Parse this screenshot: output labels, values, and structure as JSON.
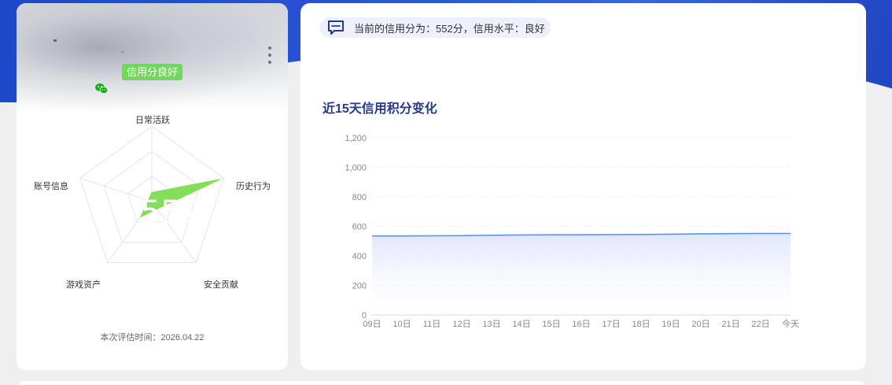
{
  "profile": {
    "name_placeholder": "-",
    "badge": "信用分良好",
    "social_icon": "wechat-icon",
    "more_icon": "more-vertical-icon"
  },
  "radar": {
    "score": "552",
    "axes": [
      {
        "label": "日常活跃",
        "value": 0.12
      },
      {
        "label": "历史行为",
        "value": 0.95
      },
      {
        "label": "安全贡献",
        "value": 0.12
      },
      {
        "label": "游戏资产",
        "value": 0.25
      },
      {
        "label": "账号信息",
        "value": 0.05
      }
    ],
    "eval_time": "本次评估时间：2026.04.22"
  },
  "notice": {
    "icon": "message-icon",
    "text": "当前的信用分为：552分，信用水平：良好"
  },
  "chart_data": {
    "type": "area",
    "title": "近15天信用积分变化",
    "categories": [
      "09日",
      "10日",
      "11日",
      "12日",
      "13日",
      "14日",
      "15日",
      "16日",
      "17日",
      "18日",
      "19日",
      "20日",
      "21日",
      "22日",
      "今天"
    ],
    "values": [
      535,
      535,
      536,
      537,
      540,
      542,
      543,
      543,
      544,
      545,
      547,
      549,
      551,
      552,
      552
    ],
    "ylim": [
      0,
      1200
    ],
    "yticks": [
      "0",
      "200",
      "400",
      "600",
      "800",
      "1,000",
      "1,200"
    ],
    "colors": {
      "line": "#5b8ff9",
      "fill": "#dfe6fd"
    }
  },
  "colors": {
    "badge": "#6fd95a",
    "radar_fill": "#7ddd4f",
    "title": "#253a8a"
  }
}
